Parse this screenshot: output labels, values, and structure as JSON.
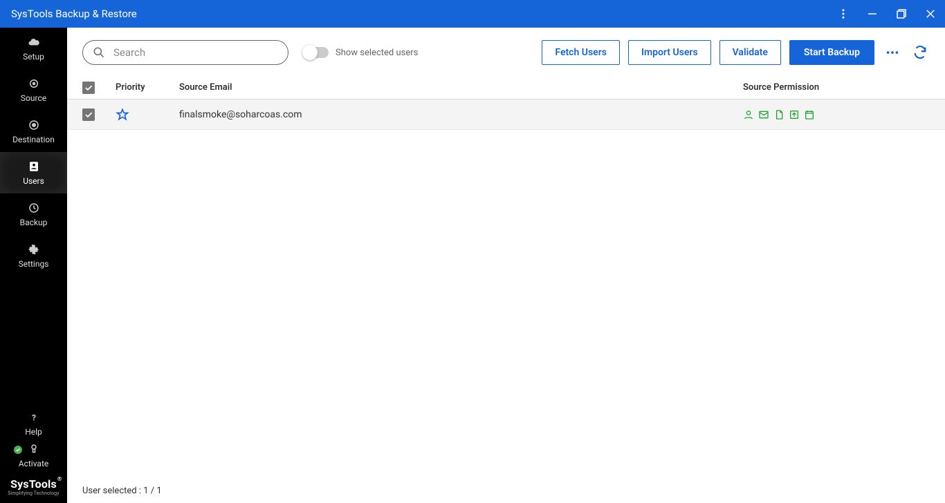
{
  "titlebar": {
    "title": "SysTools Backup & Restore"
  },
  "sidebar": {
    "items": [
      {
        "label": "Setup"
      },
      {
        "label": "Source"
      },
      {
        "label": "Destination"
      },
      {
        "label": "Users"
      },
      {
        "label": "Backup"
      },
      {
        "label": "Settings"
      }
    ],
    "bottom": [
      {
        "label": "Help"
      },
      {
        "label": "Activate"
      }
    ],
    "brand": {
      "name": "SysTools",
      "reg": "®",
      "tag": "Simplifying Technology"
    }
  },
  "toolbar": {
    "search_placeholder": "Search",
    "toggle_label": "Show selected users",
    "fetch": "Fetch Users",
    "import": "Import Users",
    "validate": "Validate",
    "start": "Start Backup"
  },
  "table": {
    "headers": {
      "priority": "Priority",
      "email": "Source Email",
      "perm": "Source Permission"
    },
    "rows": [
      {
        "email": "finalsmoke@soharcoas.com"
      }
    ]
  },
  "status": {
    "text": "User selected : 1 / 1"
  }
}
